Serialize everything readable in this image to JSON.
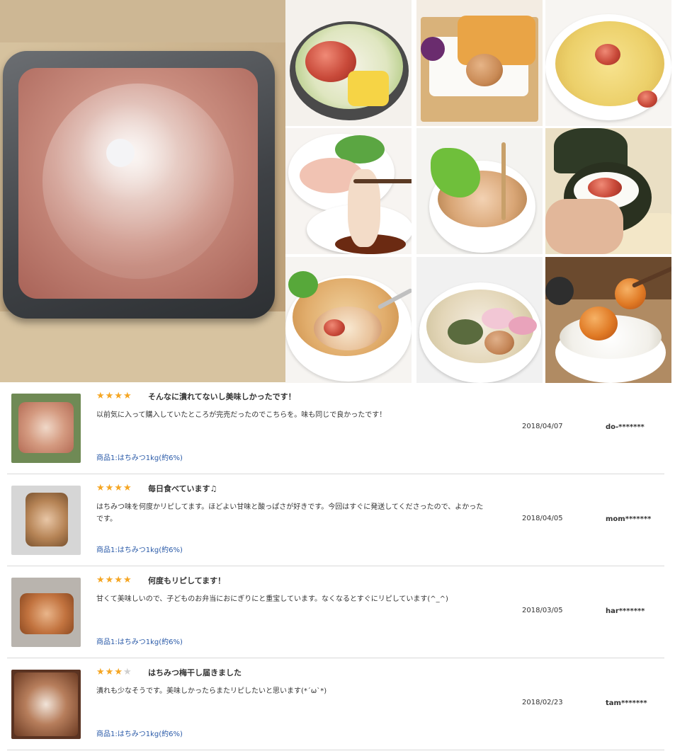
{
  "gallery": {
    "hero_icon": "umeboshi-tray-photo",
    "tiles": [
      {
        "name": "umeboshi-rice-bowl-photo"
      },
      {
        "name": "bento-box-photo"
      },
      {
        "name": "umeboshi-pasta-photo"
      },
      {
        "name": "sashimi-plum-sauce-photo"
      },
      {
        "name": "ochazuke-bowl-photo"
      },
      {
        "name": "onigiri-photo"
      },
      {
        "name": "plum-salad-spoon-photo"
      },
      {
        "name": "udon-bowl-photo"
      },
      {
        "name": "rice-with-umeboshi-photo"
      }
    ]
  },
  "colors": {
    "star": "#f5a623",
    "star_off": "#cfcfcf",
    "product_link": "#2a5aa8",
    "divider": "#d9d9d9"
  },
  "reviews": [
    {
      "rating": 4,
      "title": "そんなに潰れてないし美味しかったです！",
      "body": "以前気に入って購入していたところが完売だったのでこちらを。味も同じで良かったです！",
      "product": "商品1:はちみつ1kg(約6%)",
      "date": "2018/04/07",
      "user": "do-*******"
    },
    {
      "rating": 4,
      "title": "毎日食べています♫",
      "body": "はちみつ味を何度かリピしてます。ほどよい甘味と酸っぱさが好きです。今回はすぐに発送してくださったので、よかったです。",
      "product": "商品1:はちみつ1kg(約6%)",
      "date": "2018/04/05",
      "user": "mom*******"
    },
    {
      "rating": 4,
      "title": "何度もリピしてます！",
      "body": "甘くて美味しいので、子どものお弁当におにぎりにと重宝しています。なくなるとすぐにリピしています(^_^)",
      "product": "商品1:はちみつ1kg(約6%)",
      "date": "2018/03/05",
      "user": "har*******"
    },
    {
      "rating": 3,
      "title": "はちみつ梅干し届きました",
      "body": "潰れも少なそうです。美味しかったらまたリピしたいと思います(*´ω`*)",
      "product": "商品1:はちみつ1kg(約6%)",
      "date": "2018/02/23",
      "user": "tam*******"
    }
  ]
}
